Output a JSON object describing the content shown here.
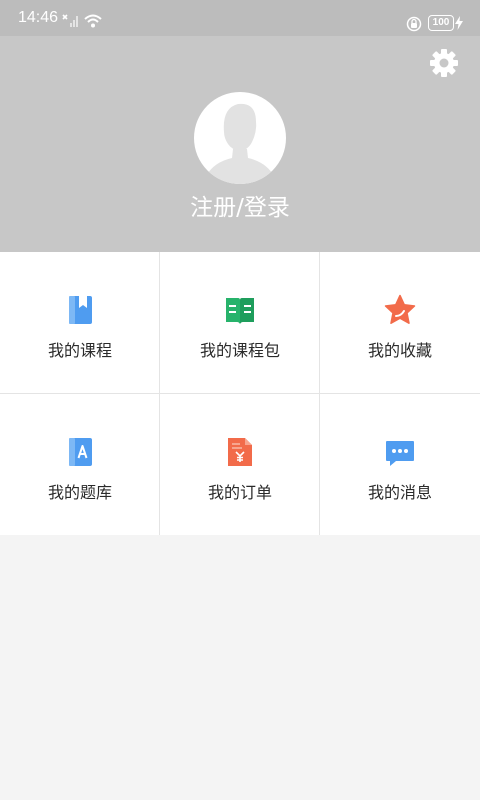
{
  "status_bar": {
    "time": "14:46",
    "battery": "100"
  },
  "header": {
    "settings_icon": "gear-icon",
    "avatar_icon": "default-user-avatar",
    "login_label": "注册/登录"
  },
  "menu": {
    "items": [
      {
        "label": "我的课程",
        "icon": "book-bookmark-icon"
      },
      {
        "label": "我的课程包",
        "icon": "open-book-icon"
      },
      {
        "label": "我的收藏",
        "icon": "star-icon"
      },
      {
        "label": "我的题库",
        "icon": "question-bank-icon"
      },
      {
        "label": "我的订单",
        "icon": "order-document-icon"
      },
      {
        "label": "我的消息",
        "icon": "message-bubble-icon"
      }
    ]
  },
  "colors": {
    "status_bar_bg": "#bcbcbc",
    "header_bg": "#c7c7c7",
    "page_bg": "#f4f4f4",
    "icon_blue": "#4f9cf0",
    "icon_green": "#27b36b",
    "icon_orange": "#f26b4a"
  }
}
